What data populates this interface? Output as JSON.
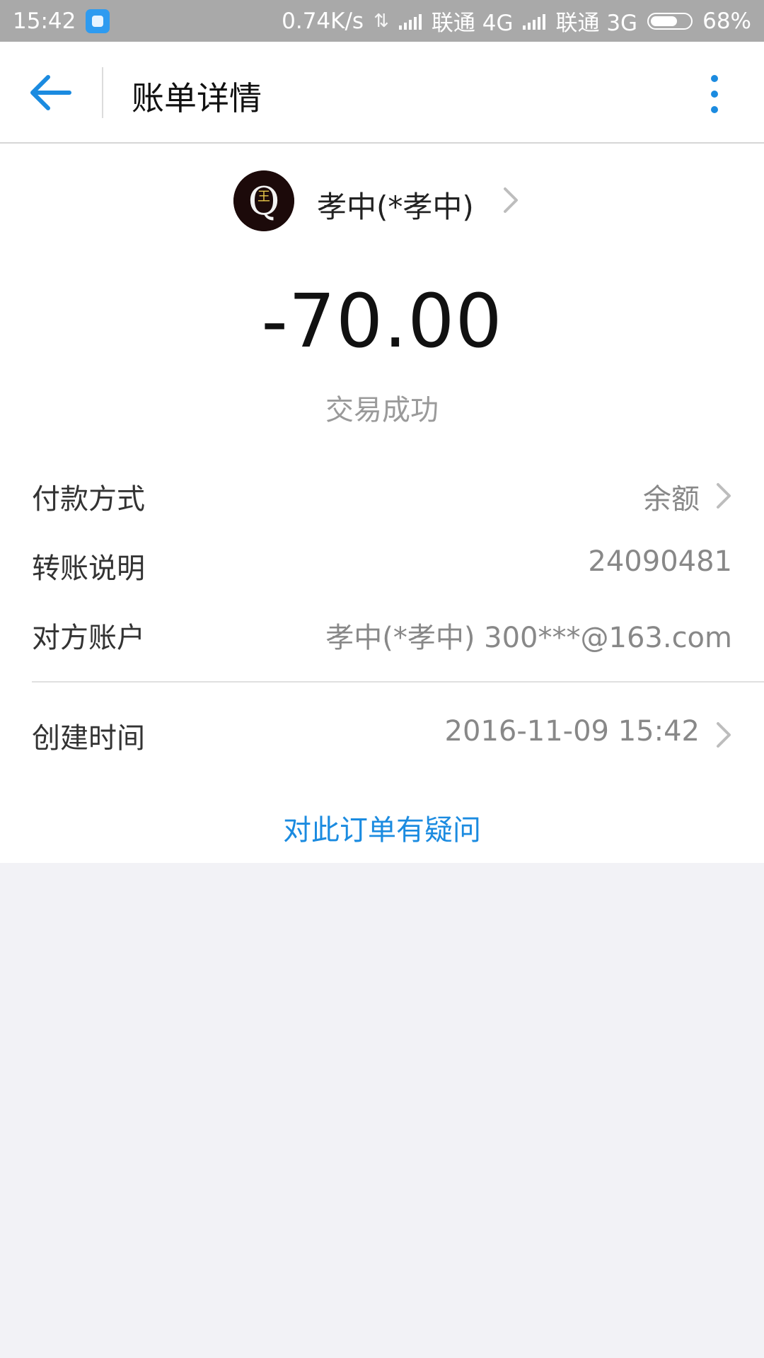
{
  "status_bar": {
    "time": "15:42",
    "net_speed": "0.74K/s",
    "carrier1": "联通 4G",
    "carrier2": "联通 3G",
    "battery_pct": "68%",
    "battery_level": 0.68
  },
  "header": {
    "title": "账单详情",
    "back_icon": "back-arrow-icon",
    "more_icon": "more-vertical-icon"
  },
  "payee": {
    "name": "孝中(*孝中)",
    "avatar_letters": "Q",
    "avatar_mark": "王"
  },
  "transaction": {
    "amount": "-70.00",
    "status": "交易成功"
  },
  "details": {
    "payment_method": {
      "label": "付款方式",
      "value": "余额"
    },
    "transfer_note": {
      "label": "转账说明",
      "value": "24090481"
    },
    "counterparty": {
      "label": "对方账户",
      "value": "孝中(*孝中) 300***@163.com"
    },
    "created_time": {
      "label": "创建时间",
      "value": "2016-11-09 15:42"
    }
  },
  "dispute_link": "对此订单有疑问",
  "colors": {
    "accent": "#1b8be0",
    "status_bar": "#a9a9a9",
    "background": "#f2f2f6"
  }
}
